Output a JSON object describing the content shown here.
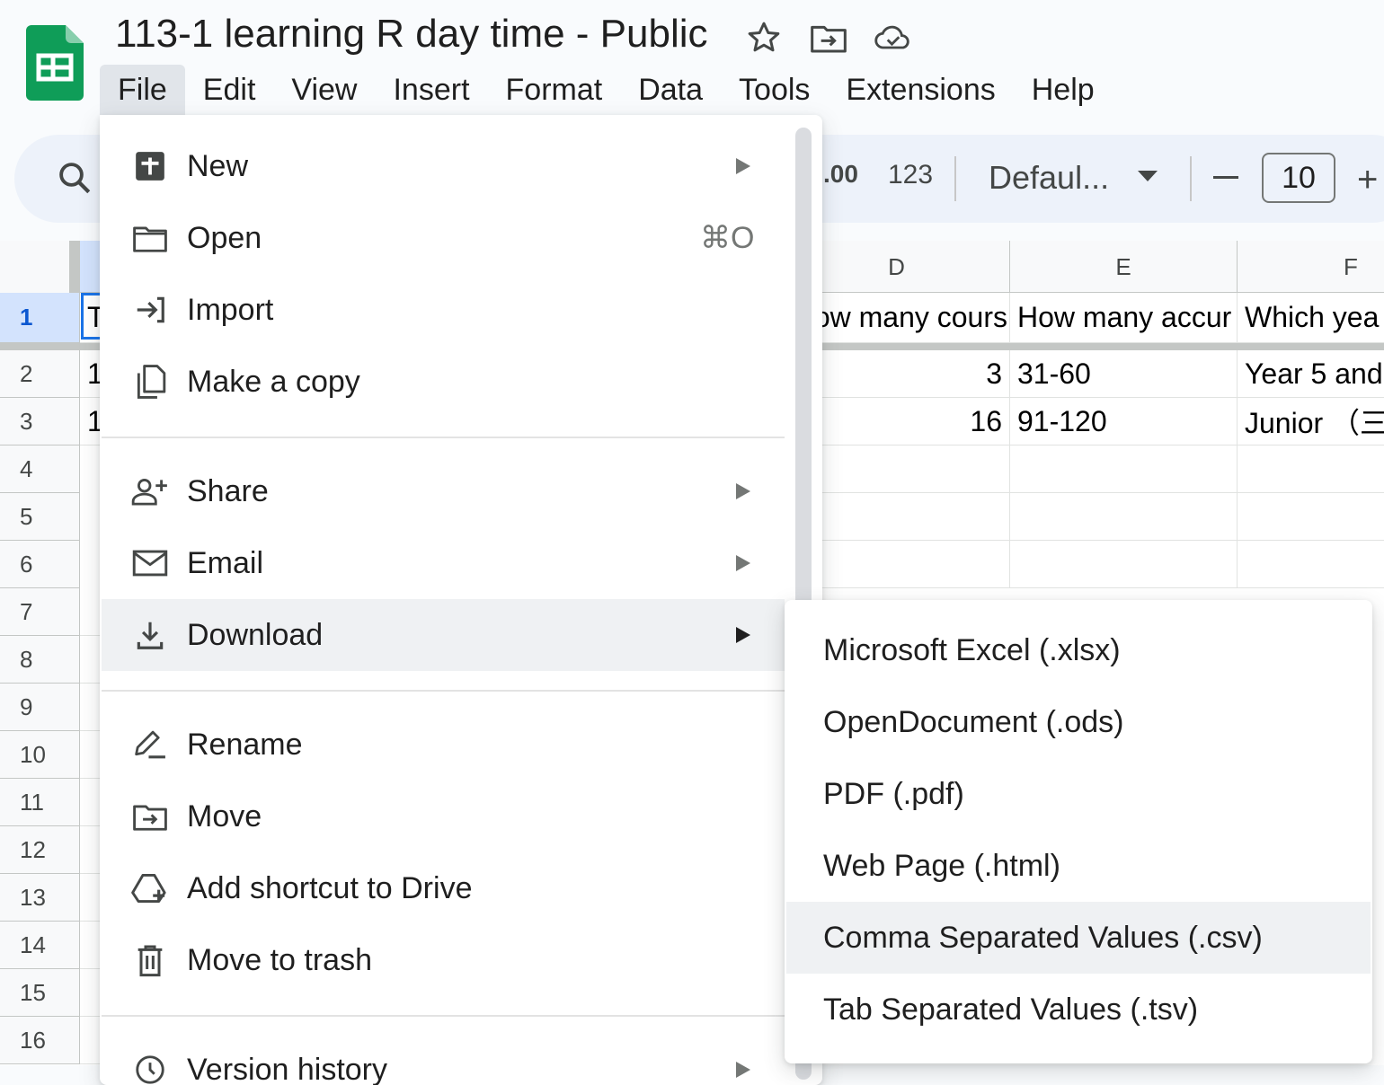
{
  "app": {
    "title": "113-1 learning R day time - Public"
  },
  "menubar": [
    "File",
    "Edit",
    "View",
    "Insert",
    "Format",
    "Data",
    "Tools",
    "Extensions",
    "Help"
  ],
  "toolbar": {
    "decimal": ".00",
    "number_format": "123",
    "font": "Defaul...",
    "font_size": "10",
    "minus": "−",
    "plus": "+"
  },
  "grid": {
    "columns": [
      "D",
      "E",
      "F"
    ],
    "rows": [
      "1",
      "2",
      "3",
      "4",
      "5",
      "6",
      "7",
      "8",
      "9",
      "10",
      "11",
      "12",
      "13",
      "14",
      "15",
      "16"
    ],
    "first_col_fragments": [
      "T",
      "1",
      "1"
    ],
    "cells": [
      [
        "ow many cours",
        "How many accur",
        "Which yea"
      ],
      [
        "3",
        "31-60",
        "Year 5 and"
      ],
      [
        "16",
        "91-120",
        "Junior （三"
      ]
    ]
  },
  "file_menu": {
    "items": [
      {
        "label": "New",
        "icon": "new-sheet-icon",
        "submenu": true
      },
      {
        "label": "Open",
        "icon": "folder-icon",
        "shortcut": "⌘O"
      },
      {
        "label": "Import",
        "icon": "import-icon"
      },
      {
        "label": "Make a copy",
        "icon": "copy-icon"
      },
      {
        "label": "Share",
        "icon": "person-add-icon",
        "submenu": true
      },
      {
        "label": "Email",
        "icon": "mail-icon",
        "submenu": true
      },
      {
        "label": "Download",
        "icon": "download-icon",
        "submenu": true,
        "highlighted": true
      },
      {
        "label": "Rename",
        "icon": "rename-icon"
      },
      {
        "label": "Move",
        "icon": "move-folder-icon"
      },
      {
        "label": "Add shortcut to Drive",
        "icon": "drive-shortcut-icon"
      },
      {
        "label": "Move to trash",
        "icon": "trash-icon"
      },
      {
        "label": "Version history",
        "icon": "history-icon",
        "submenu": true
      }
    ]
  },
  "download_menu": {
    "items": [
      "Microsoft Excel (.xlsx)",
      "OpenDocument (.ods)",
      "PDF (.pdf)",
      "Web Page (.html)",
      "Comma Separated Values (.csv)",
      "Tab Separated Values (.tsv)"
    ],
    "highlighted_index": 4
  },
  "colors": {
    "sheets_green": "#0f9d58",
    "accent_blue": "#1a73e8",
    "toolbar_bg": "#edf2fa",
    "highlight": "#eff1f3"
  }
}
